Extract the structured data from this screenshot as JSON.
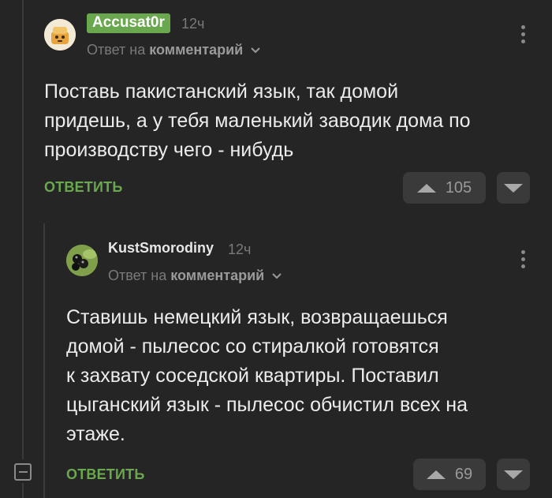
{
  "comment1": {
    "author": "Accusat0r",
    "time": "12ч",
    "reply_prefix": "Ответ на",
    "reply_target": "комментарий",
    "text_lines": [
      "Поставь пакистанский язык, так домой",
      "придешь, а у тебя маленький заводик дома по",
      "производству чего - нибудь"
    ],
    "reply_label": "ОТВЕТИТЬ",
    "votes": "105"
  },
  "comment2": {
    "author": "KustSmorodiny",
    "time": "12ч",
    "reply_prefix": "Ответ на",
    "reply_target": "комментарий",
    "text_lines": [
      "Ставишь немецкий язык, возвращаешься",
      "домой - пылесос со стиралкой готовятся",
      "к захвату соседской квартиры. Поставил",
      "цыганский язык - пылесос обчистил всех на",
      "этаже."
    ],
    "reply_label": "ОТВЕТИТЬ",
    "votes": "69"
  },
  "colors": {
    "accent": "#6aa84f",
    "background": "#252525"
  }
}
